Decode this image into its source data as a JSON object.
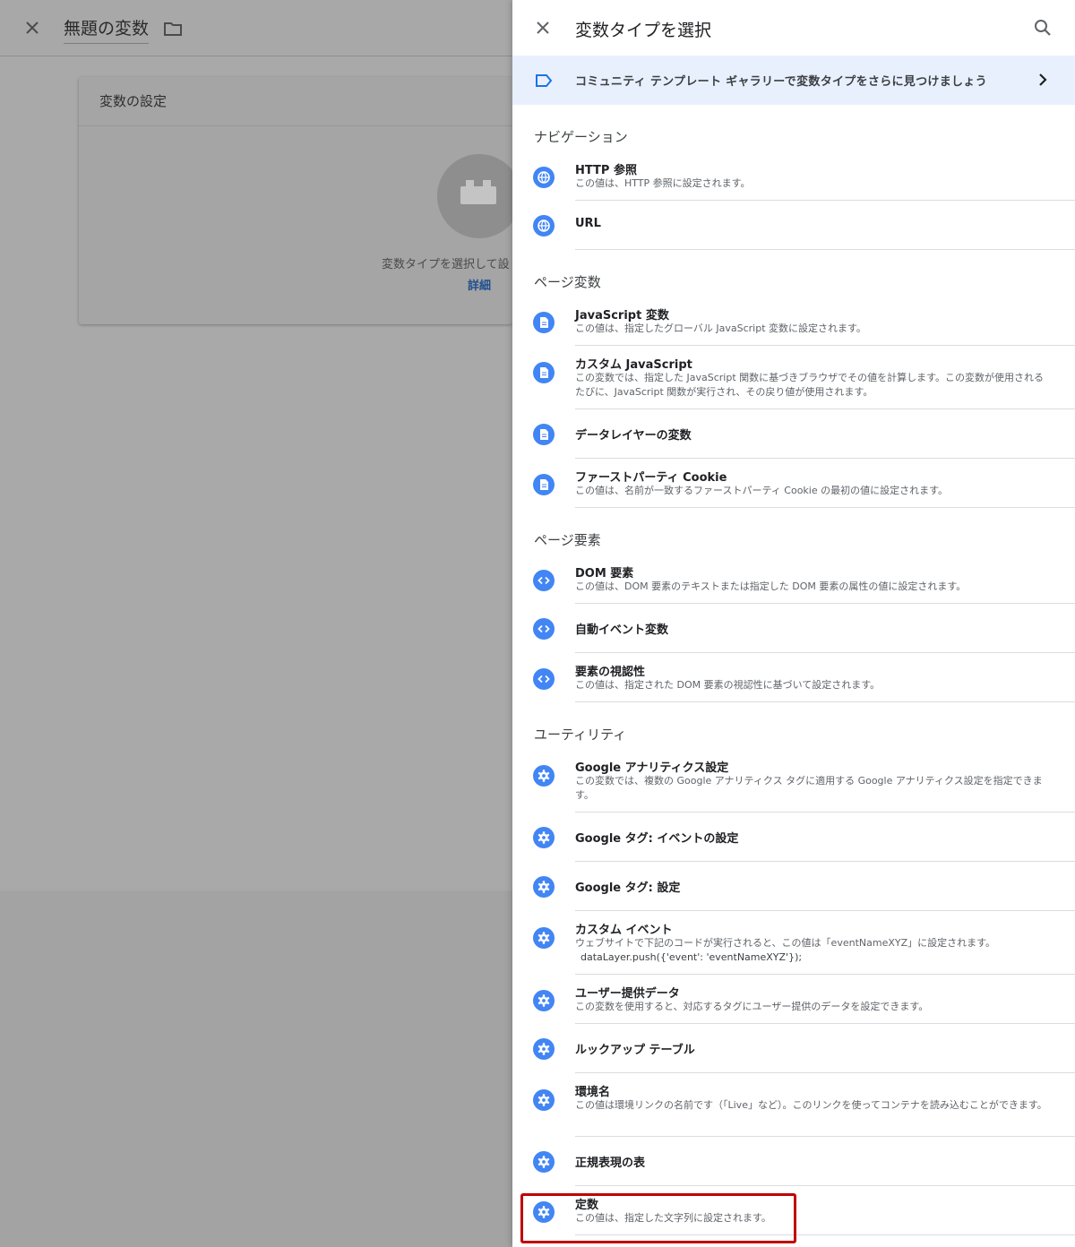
{
  "background": {
    "title": "無題の変数",
    "card_title": "変数の設定",
    "hint": "変数タイプを選択して設",
    "detail_link": "詳細"
  },
  "panel": {
    "title": "変数タイプを選択",
    "banner_text": "コミュニティ テンプレート ギャラリーで変数タイプをさらに見つけましょう"
  },
  "sections": [
    {
      "title": "ナビゲーション",
      "items": [
        {
          "icon": "globe-icon",
          "title": "HTTP 参照",
          "desc": "この値は、HTTP 参照に設定されます。"
        },
        {
          "icon": "globe-icon",
          "title": "URL",
          "desc": ""
        }
      ]
    },
    {
      "title": "ページ変数",
      "items": [
        {
          "icon": "document-icon",
          "title": "JavaScript 変数",
          "desc": "この値は、指定したグローバル JavaScript 変数に設定されます。"
        },
        {
          "icon": "document-icon",
          "title": "カスタム JavaScript",
          "desc": "この変数では、指定した JavaScript 関数に基づきブラウザでその値を計算します。この変数が使用されるたびに、JavaScript 関数が実行され、その戻り値が使用されます。"
        },
        {
          "icon": "document-icon",
          "title": "データレイヤーの変数",
          "desc": ""
        },
        {
          "icon": "document-icon",
          "title": "ファーストパーティ Cookie",
          "desc": "この値は、名前が一致するファーストパーティ Cookie の最初の値に設定されます。"
        }
      ]
    },
    {
      "title": "ページ要素",
      "items": [
        {
          "icon": "code-icon",
          "title": "DOM 要素",
          "desc": "この値は、DOM 要素のテキストまたは指定した DOM 要素の属性の値に設定されます。"
        },
        {
          "icon": "code-icon",
          "title": "自動イベント変数",
          "desc": ""
        },
        {
          "icon": "code-icon",
          "title": "要素の視認性",
          "desc": "この値は、指定された DOM 要素の視認性に基づいて設定されます。"
        }
      ]
    },
    {
      "title": "ユーティリティ",
      "items": [
        {
          "icon": "gear-icon",
          "title": "Google アナリティクス設定",
          "desc": "この変数では、複数の Google アナリティクス タグに適用する Google アナリティクス設定を指定できます。"
        },
        {
          "icon": "gear-icon",
          "title": "Google タグ: イベントの設定",
          "desc": ""
        },
        {
          "icon": "gear-icon",
          "title": "Google タグ: 設定",
          "desc": ""
        },
        {
          "icon": "gear-icon",
          "title": "カスタム イベント",
          "desc": "ウェブサイトで下記のコードが実行されると、この値は「eventNameXYZ」に設定されます。",
          "code": "dataLayer.push({'event': 'eventNameXYZ'});"
        },
        {
          "icon": "gear-icon",
          "title": "ユーザー提供データ",
          "desc": "この変数を使用すると、対応するタグにユーザー提供のデータを設定できます。"
        },
        {
          "icon": "gear-icon",
          "title": "ルックアップ テーブル",
          "desc": ""
        },
        {
          "icon": "gear-icon",
          "title": "環境名",
          "desc": "この値は環境リンクの名前です（「Live」など）。このリンクを使ってコンテナを読み込むことができます。"
        },
        {
          "icon": "gear-icon",
          "title": "正規表現の表",
          "desc": ""
        },
        {
          "icon": "gear-icon",
          "title": "定数",
          "desc": "この値は、指定した文字列に設定されます。"
        }
      ]
    }
  ],
  "colors": {
    "accent": "#4285f4",
    "banner_bg": "#e8f0fe",
    "highlight": "#c00000"
  }
}
